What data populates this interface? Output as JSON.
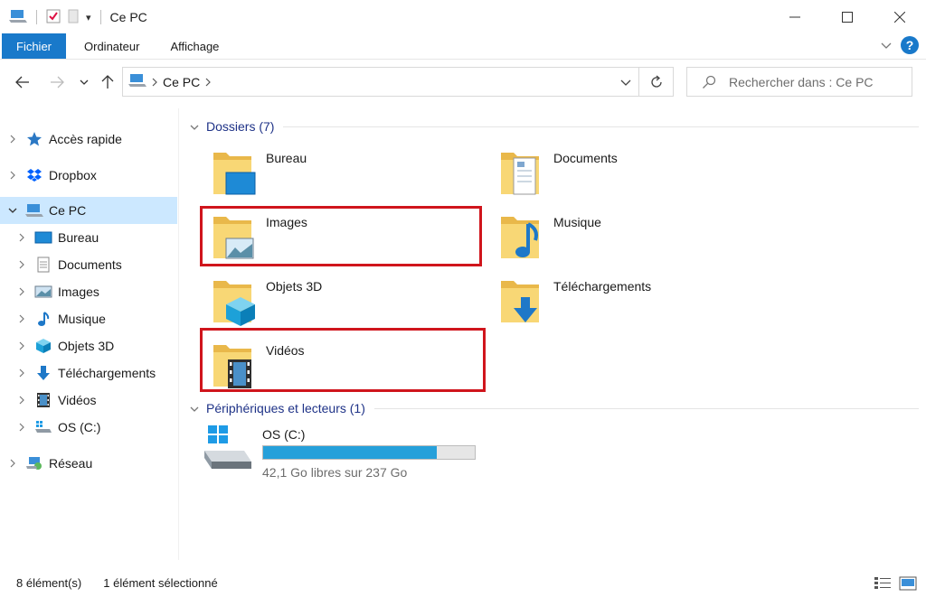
{
  "window": {
    "title": "Ce PC",
    "minimize_icon": "minimize-icon",
    "maximize_icon": "maximize-icon",
    "close_icon": "close-icon"
  },
  "ribbon": {
    "tabs": [
      {
        "label": "Fichier",
        "active": true
      },
      {
        "label": "Ordinateur"
      },
      {
        "label": "Affichage"
      }
    ],
    "help_label": "?"
  },
  "address": {
    "crumbs": [
      "Ce PC"
    ],
    "search_placeholder": "Rechercher dans : Ce PC"
  },
  "nav": {
    "items": [
      {
        "label": "Accès rapide",
        "icon": "star-icon"
      },
      {
        "label": "Dropbox",
        "icon": "dropbox-icon"
      },
      {
        "label": "Ce PC",
        "icon": "computer-icon",
        "selected": true,
        "expanded": true
      },
      {
        "label": "Bureau",
        "icon": "desktop-icon"
      },
      {
        "label": "Documents",
        "icon": "document-icon"
      },
      {
        "label": "Images",
        "icon": "pictures-icon"
      },
      {
        "label": "Musique",
        "icon": "music-icon"
      },
      {
        "label": "Objets 3D",
        "icon": "cube-icon"
      },
      {
        "label": "Téléchargements",
        "icon": "download-icon"
      },
      {
        "label": "Vidéos",
        "icon": "film-icon"
      },
      {
        "label": "OS (C:)",
        "icon": "drive-icon"
      },
      {
        "label": "Réseau",
        "icon": "network-icon"
      }
    ]
  },
  "content": {
    "folders_header": "Dossiers (7)",
    "folders": [
      {
        "label": "Bureau"
      },
      {
        "label": "Documents"
      },
      {
        "label": "Images"
      },
      {
        "label": "Musique"
      },
      {
        "label": "Objets 3D"
      },
      {
        "label": "Téléchargements"
      },
      {
        "label": "Vidéos"
      }
    ],
    "devices_header": "Périphériques et lecteurs (1)",
    "drive": {
      "label": "OS (C:)",
      "info": "42,1 Go libres sur 237 Go",
      "used_fraction": 0.82
    }
  },
  "status": {
    "count": "8 élément(s)",
    "selection": "1 élément sélectionné"
  },
  "colors": {
    "accent": "#1979ca",
    "selection": "#cce8ff",
    "highlight": "#d0151c",
    "folder": "#f8d775",
    "drive_fill": "#26a0da"
  }
}
